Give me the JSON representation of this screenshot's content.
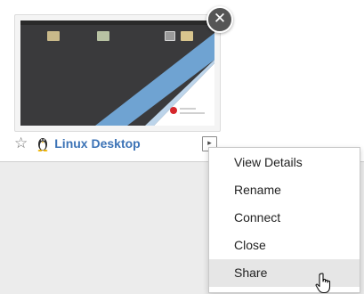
{
  "card": {
    "title": "Linux Desktop",
    "close_glyph": "✕",
    "star_glyph": "☆",
    "menu_toggle_glyph": "▸",
    "icons": {
      "star": "star-icon",
      "os": "linux-penguin-icon",
      "close": "close-icon"
    }
  },
  "context_menu": {
    "items": [
      {
        "label": "View Details"
      },
      {
        "label": "Rename"
      },
      {
        "label": "Connect"
      },
      {
        "label": "Close"
      },
      {
        "label": "Share",
        "hovered": true
      }
    ]
  },
  "colors": {
    "title_link": "#3c73b6",
    "thumbnail_stripe": "#6fa3d2",
    "brand_red": "#d5262b"
  }
}
